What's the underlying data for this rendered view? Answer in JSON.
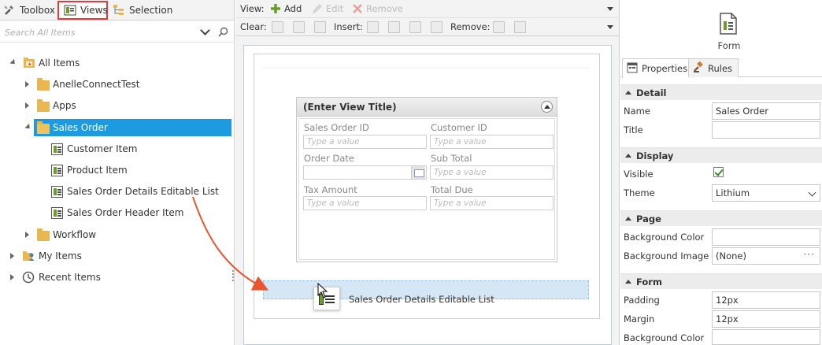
{
  "left_tabs": {
    "toolbox": "Toolbox",
    "views": "Views",
    "selection": "Selection"
  },
  "search": {
    "placeholder": "Search All Items"
  },
  "tree": {
    "all_items": "All Items",
    "anelle": "AnelleConnectTest",
    "apps": "Apps",
    "sales_order": "Sales Order",
    "customer_item": "Customer Item",
    "product_item": "Product Item",
    "sales_order_details": "Sales Order Details Editable List",
    "sales_order_header": "Sales Order Header Item",
    "workflow": "Workflow",
    "my_items": "My Items",
    "recent_items": "Recent Items"
  },
  "toolbar": {
    "view_label": "View:",
    "add": "Add",
    "edit": "Edit",
    "remove": "Remove",
    "clear_label": "Clear:",
    "insert_label": "Insert:",
    "remove_label": "Remove:"
  },
  "view_card": {
    "title": "(Enter View Title)",
    "fields": [
      {
        "label": "Sales Order ID",
        "placeholder": "Type a value"
      },
      {
        "label": "Customer ID",
        "placeholder": "Type a value"
      },
      {
        "label": "Order Date",
        "placeholder": ""
      },
      {
        "label": "Sub Total",
        "placeholder": "Type a value"
      },
      {
        "label": "Tax Amount",
        "placeholder": "Type a value"
      },
      {
        "label": "Total Due",
        "placeholder": "Type a value"
      }
    ]
  },
  "drag": {
    "label": "Sales Order Details Editable List"
  },
  "right": {
    "title": "Form",
    "tabs": {
      "properties": "Properties",
      "rules": "Rules"
    },
    "sections": {
      "detail": "Detail",
      "display": "Display",
      "page": "Page",
      "form": "Form"
    },
    "props": {
      "name_label": "Name",
      "name_value": "Sales Order",
      "title_label": "Title",
      "title_value": "",
      "visible_label": "Visible",
      "theme_label": "Theme",
      "theme_value": "Lithium",
      "bg_color_label": "Background Color",
      "bg_image_label": "Background Image",
      "bg_image_value": "(None)",
      "padding_label": "Padding",
      "padding_value": "12px",
      "margin_label": "Margin",
      "margin_value": "12px",
      "form_bg_color_label": "Background Color"
    }
  },
  "colors": {
    "selection_blue": "#1e9be0",
    "views_highlight": "#e53b3b",
    "arrow": "#e8552e",
    "drop_zone": "#d5e6f5"
  }
}
